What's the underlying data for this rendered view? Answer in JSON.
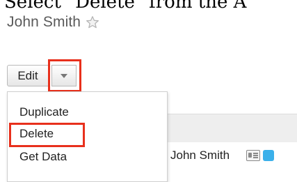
{
  "instruction": {
    "text": "Select \"Delete\" from the A"
  },
  "record": {
    "name": "John Smith",
    "favorite_icon": "star-icon"
  },
  "toolbar": {
    "edit_label": "Edit",
    "dropdown_icon": "chevron-down-icon"
  },
  "menu": {
    "items": [
      {
        "label": "Duplicate"
      },
      {
        "label": "Delete"
      },
      {
        "label": "Get Data"
      }
    ]
  },
  "list": {
    "row_name": "John Smith",
    "icons": [
      "vcard-icon",
      "twitter-icon"
    ]
  },
  "colors": {
    "highlight": "#e8301c",
    "twitter": "#3bb0ea"
  }
}
